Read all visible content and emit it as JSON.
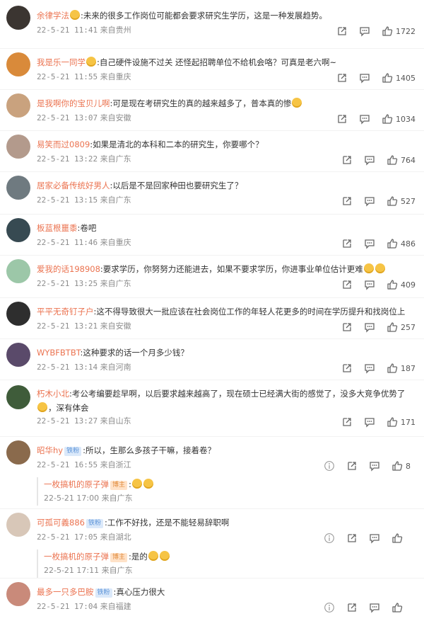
{
  "comments": [
    {
      "user": "余律学法",
      "text": ":未来的很多工作岗位可能都会要求研究生学历，这是一种发展趋势。",
      "date": "22-5-21 11:41",
      "source": "来自贵州",
      "likes": "1722",
      "avatar_color": "#3b3531"
    },
    {
      "user": "我是乐一同学",
      "text": ":自己硬件设施不过关 还怪起招聘单位不给机会咯？可真是老六啊~",
      "date": "22-5-21 11:55",
      "source": "来自重庆",
      "likes": "1405",
      "avatar_color": "#d98a3a"
    },
    {
      "user": "是我啊你的宝贝儿啊",
      "text": ":可是现在考研究生的真的越来越多了，普本真的惨",
      "date": "22-5-21 13:07",
      "source": "来自安徽",
      "likes": "1034",
      "avatar_color": "#c9a27e"
    },
    {
      "user": "易笑而过0809",
      "text": ":如果是清北的本科和二本的研究生，你要哪个？",
      "date": "22-5-21 13:22",
      "source": "来自广东",
      "likes": "764",
      "avatar_color": "#b39a8c"
    },
    {
      "user": "居家必备传统好男人",
      "text": ":以后是不是回家种田也要研究生了？",
      "date": "22-5-21 13:15",
      "source": "来自广东",
      "likes": "527",
      "avatar_color": "#6f7a80"
    },
    {
      "user": "板蓝根噩黍",
      "text": ":卷吧",
      "date": "22-5-21 11:46",
      "source": "来自重庆",
      "likes": "486",
      "avatar_color": "#374a52"
    },
    {
      "user": "爱我的话198908",
      "text": ":要求学历，你努努力还能进去，如果不要求学历，你进事业单位估计更难",
      "date": "22-5-21 13:25",
      "source": "来自广东",
      "likes": "409",
      "avatar_color": "#9cc7a8"
    },
    {
      "user": "平平无奇钉子户",
      "text": ":这不得导致很大一批应该在社会岗位工作的年轻人花更多的时间在学历提升和找岗位上",
      "date": "22-5-21 13:21",
      "source": "来自安徽",
      "likes": "257",
      "avatar_color": "#2e2e2e"
    },
    {
      "user": "WYBFBTBT",
      "text": ":这种要求的话一个月多少钱？",
      "date": "22-5-21 13:14",
      "source": "来自河南",
      "likes": "187",
      "avatar_color": "#5a4a6a"
    },
    {
      "user": "朽木小北",
      "text": ":考公考编要趁早啊，以后要求越来越高了，现在硕士已经满大街的感觉了，没多大竞争优势了",
      "text2": "，深有体会",
      "date": "22-5-21 13:27",
      "source": "来自山东",
      "likes": "171",
      "avatar_color": "#3f5c3a"
    },
    {
      "user": "昭华hy",
      "badge": "铁粉",
      "text": ":所以，生那么多孩子干嘛，接着卷？",
      "date": "22-5-21 16:55",
      "source": "来自浙江",
      "likes": "8",
      "avatar_color": "#8a6a4c",
      "reply": {
        "user": "一枚搞机的原子弹",
        "badge": "博主",
        "text": ":",
        "date": "22-5-21 17:00",
        "source": "来自广东"
      }
    },
    {
      "user": "可孤可義886",
      "badge": "铁粉",
      "text": ":工作不好找，还是不能轻易辞职啊",
      "date": "22-5-21 17:05",
      "source": "来自湖北",
      "likes": "",
      "avatar_color": "#d8c7b8",
      "reply": {
        "user": "一枚搞机的原子弹",
        "badge": "博主",
        "text": ":是的",
        "date": "22-5-21 17:11",
        "source": "来自广东"
      }
    },
    {
      "user": "最多一只多巴胺",
      "badge": "铁粉",
      "text": ":真心压力很大",
      "date": "22-5-21 17:04",
      "source": "来自福建",
      "likes": "",
      "avatar_color": "#c98a7a"
    }
  ],
  "colors": {
    "username": "#eb7350",
    "meta": "#8c8c8c",
    "badge_orange": "#e08a3a",
    "badge_blue": "#5b93d8"
  },
  "icons": {
    "share": "share-icon",
    "comment": "comment-icon",
    "like": "thumbs-up-icon",
    "more": "more-icon"
  }
}
